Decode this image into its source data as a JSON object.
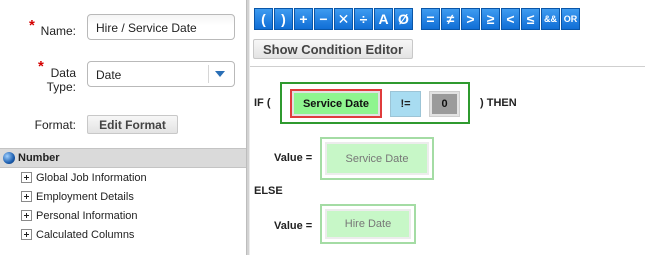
{
  "form": {
    "name_label": "Name:",
    "name_value": "Hire / Service Date",
    "data_type_label_1": "Data",
    "data_type_label_2": "Type:",
    "data_type_value": "Date",
    "format_label": "Format:",
    "edit_format_label": "Edit Format",
    "required_mark": "*"
  },
  "tree": {
    "header": "Number",
    "items": [
      {
        "label": "Global Job Information"
      },
      {
        "label": "Employment Details"
      },
      {
        "label": "Personal Information"
      },
      {
        "label": "Calculated Columns"
      }
    ]
  },
  "toolbar": {
    "buttons": [
      {
        "name": "open-paren-button",
        "glyph": "("
      },
      {
        "name": "close-paren-button",
        "glyph": ")"
      },
      {
        "name": "plus-button",
        "glyph": "+"
      },
      {
        "name": "minus-button",
        "glyph": "−"
      },
      {
        "name": "multiply-button",
        "glyph": "✕"
      },
      {
        "name": "divide-button",
        "glyph": "÷"
      },
      {
        "name": "text-button",
        "glyph": "A"
      },
      {
        "name": "null-button",
        "glyph": "Ø"
      },
      {
        "name": "equals-button",
        "glyph": "="
      },
      {
        "name": "not-equals-button",
        "glyph": "≠"
      },
      {
        "name": "greater-than-button",
        "glyph": ">"
      },
      {
        "name": "greater-equal-button",
        "glyph": "≥"
      },
      {
        "name": "less-than-button",
        "glyph": "<"
      },
      {
        "name": "less-equal-button",
        "glyph": "≤"
      },
      {
        "name": "and-button",
        "glyph": "&&"
      },
      {
        "name": "or-button",
        "glyph": "OR"
      }
    ],
    "show_condition_editor": "Show Condition Editor"
  },
  "condition": {
    "if_label": "IF (",
    "then_label": ") THEN",
    "lhs": "Service Date",
    "operator": "!=",
    "rhs": "0",
    "value_label": "Value =",
    "then_value": "Service Date",
    "else_label": "ELSE",
    "else_value": "Hire Date"
  },
  "colors": {
    "toolbar_blue": "#1f7fe6",
    "condition_border": "#2f9a2f",
    "selected_border": "#e03b3b",
    "field_green": "#8ff58f",
    "operator_blue": "#a8dcf1",
    "required_red": "#d40000"
  }
}
